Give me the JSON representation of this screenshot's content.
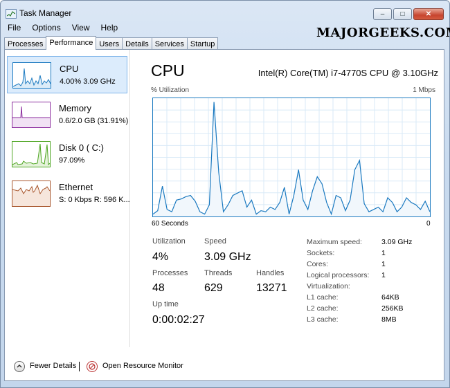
{
  "window": {
    "title": "Task Manager",
    "minimize_glyph": "–",
    "maximize_glyph": "□",
    "close_glyph": "✕"
  },
  "watermark": "MAJORGEEKS.COM",
  "menu": [
    "File",
    "Options",
    "View",
    "Help"
  ],
  "tabs": [
    "Processes",
    "Performance",
    "Users",
    "Details",
    "Services",
    "Startup"
  ],
  "active_tab": "Performance",
  "sidebar": {
    "items": [
      {
        "name": "CPU",
        "detail": "4.00%  3.09 GHz",
        "color": "#1a79c0"
      },
      {
        "name": "Memory",
        "detail": "0.6/2.0 GB (31.91%)",
        "color": "#8b2c9d"
      },
      {
        "name": "Disk 0 ( C:)",
        "detail": "97.09%",
        "color": "#4da521"
      },
      {
        "name": "Ethernet",
        "detail": "S: 0 Kbps R: 596 K...",
        "color": "#a7542a"
      }
    ]
  },
  "main": {
    "title": "CPU",
    "cpu_model": "Intel(R) Core(TM) i7-4770S CPU @ 3.10GHz",
    "graph_label_left": "% Utilization",
    "graph_label_right": "1 Mbps",
    "graph_time_left": "60 Seconds",
    "graph_time_right": "0",
    "graph_color": "#1a79c0"
  },
  "stats": {
    "utilization_label": "Utilization",
    "utilization_value": "4%",
    "speed_label": "Speed",
    "speed_value": "3.09 GHz",
    "processes_label": "Processes",
    "processes_value": "48",
    "threads_label": "Threads",
    "threads_value": "629",
    "handles_label": "Handles",
    "handles_value": "13271",
    "uptime_label": "Up time",
    "uptime_value": "0:00:02:27"
  },
  "properties": [
    {
      "label": "Maximum speed:",
      "value": "3.09 GHz"
    },
    {
      "label": "Sockets:",
      "value": "1"
    },
    {
      "label": "Cores:",
      "value": "1"
    },
    {
      "label": "Logical processors:",
      "value": "1"
    },
    {
      "label": "Virtualization:",
      "value": ""
    },
    {
      "label": "L1 cache:",
      "value": "64KB"
    },
    {
      "label": "L2 cache:",
      "value": "256KB"
    },
    {
      "label": "L3 cache:",
      "value": "8MB"
    }
  ],
  "footer": {
    "fewer_details": "Fewer Details",
    "open_resource_monitor": "Open Resource Monitor"
  },
  "chart_data": {
    "type": "area",
    "series": [
      {
        "values": [
          2,
          5,
          26,
          6,
          4,
          14,
          15,
          17,
          18,
          13,
          4,
          2,
          10,
          98,
          38,
          4,
          10,
          18,
          20,
          22,
          8,
          14,
          2,
          5,
          4,
          8,
          6,
          12,
          25,
          2,
          18,
          40,
          14,
          6,
          22,
          34,
          28,
          12,
          2,
          18,
          16,
          5,
          14,
          40,
          48,
          11,
          4,
          6,
          8,
          4,
          16,
          12,
          4,
          8,
          16,
          12,
          10,
          6,
          13,
          4
        ]
      }
    ],
    "ylim": [
      0,
      100
    ]
  }
}
